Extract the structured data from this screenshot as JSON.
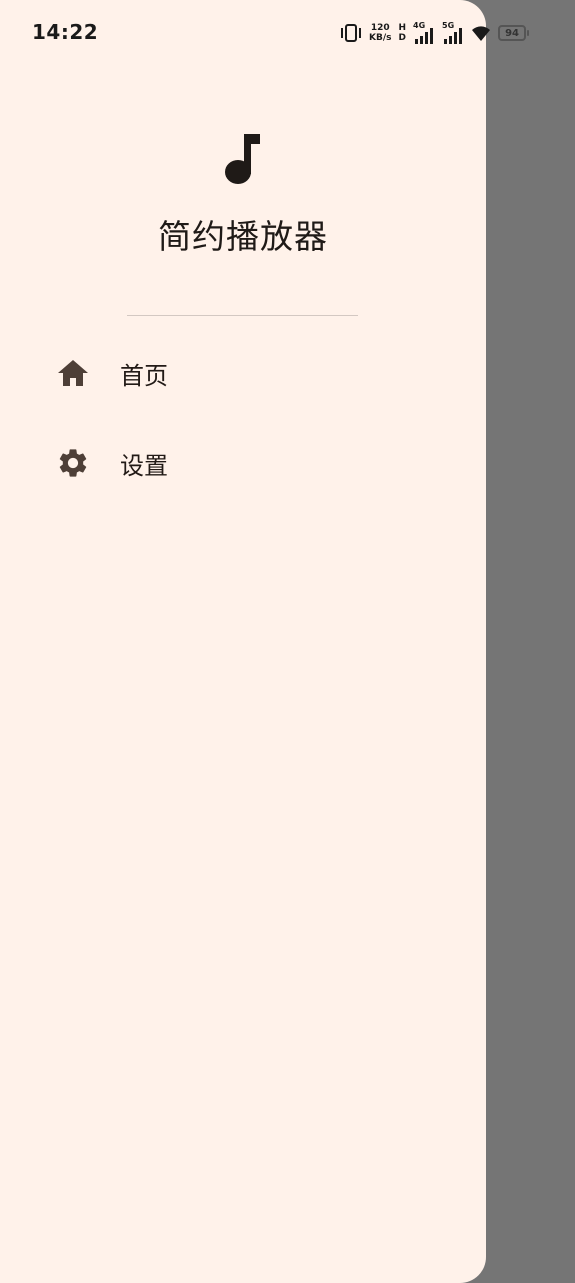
{
  "status_bar": {
    "time": "14:22",
    "net_speed_value": "120",
    "net_speed_unit": "KB/s",
    "hd_top": "H",
    "hd_bottom": "D",
    "signal_1_label": "4G",
    "signal_2_label": "5G",
    "battery": "94"
  },
  "drawer": {
    "app_icon": "music-note-icon",
    "app_title": "简约播放器",
    "items": [
      {
        "icon": "home-icon",
        "label": "首页"
      },
      {
        "icon": "gear-icon",
        "label": "设置"
      }
    ]
  },
  "colors": {
    "drawer_background": "#fff2ea",
    "scrim": "#757575",
    "icon": "#4e3f37",
    "text": "#221a16"
  }
}
